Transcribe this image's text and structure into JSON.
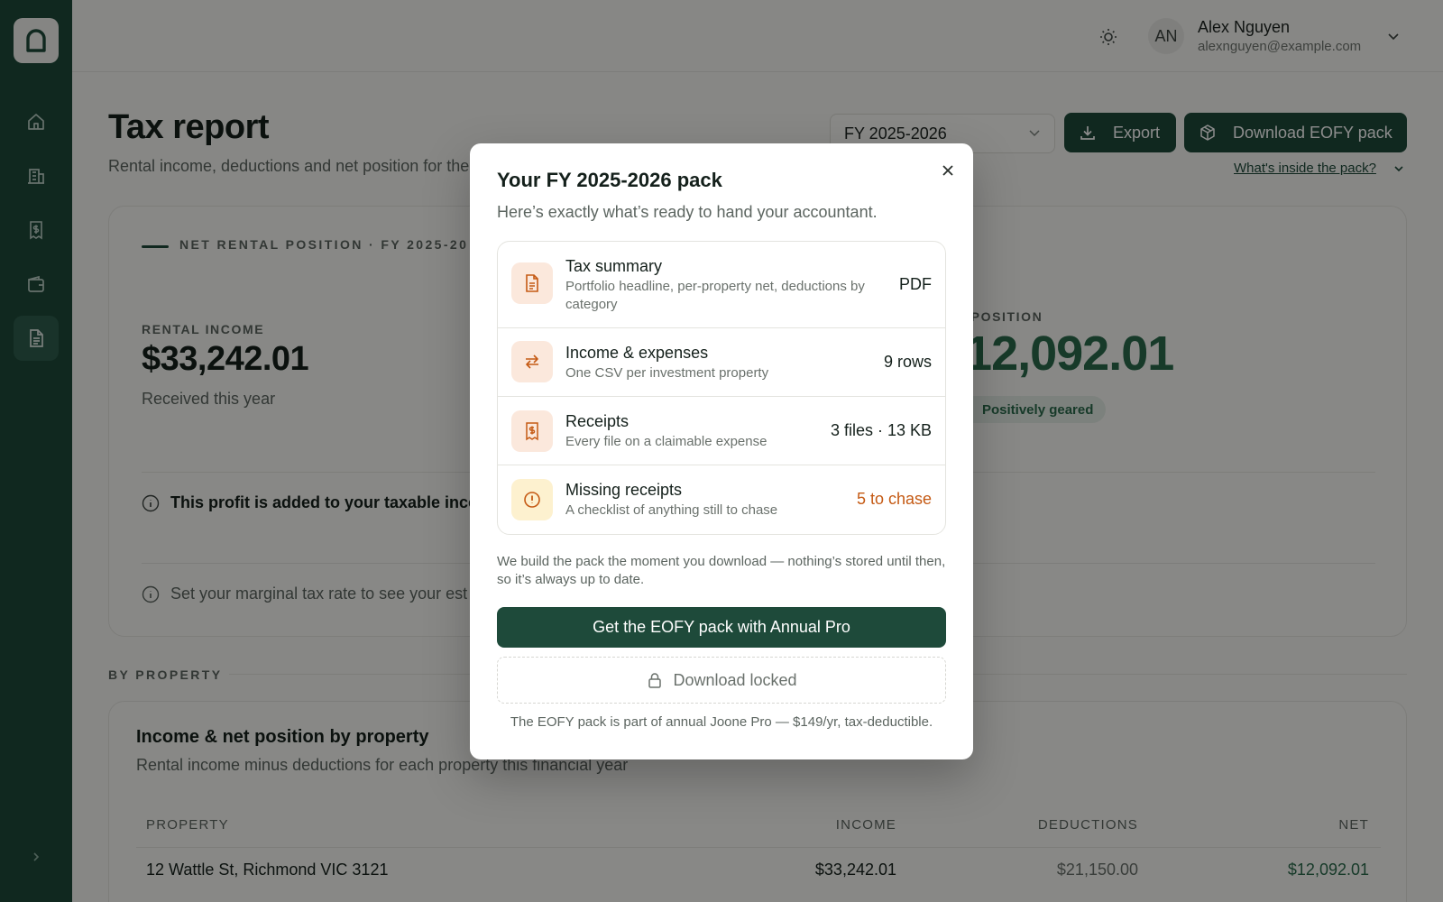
{
  "user": {
    "initials": "AN",
    "name": "Alex Nguyen",
    "email": "alexnguyen@example.com"
  },
  "header": {
    "title": "Tax report",
    "subtitle": "Rental income, deductions and net position for the",
    "fy_select": "FY 2025-2026",
    "export_label": "Export",
    "eofy_label": "Download EOFY pack",
    "inside_link": "What's inside the pack?"
  },
  "summary": {
    "eyebrow": "NET RENTAL POSITION · FY 2025-20",
    "income_label": "RENTAL INCOME",
    "income_value": "$33,242.01",
    "income_sub": "Received this year",
    "net_label": "T POSITION",
    "net_value": "$12,092.01",
    "net_badge": "Positively geared",
    "info1": "This profit is added to your taxable inco",
    "info2": "Set your marginal tax rate to see your est"
  },
  "by_property": {
    "section_label": "BY PROPERTY",
    "title": "Income & net position by property",
    "subtitle": "Rental income minus deductions for each property this financial year",
    "columns": [
      "PROPERTY",
      "INCOME",
      "DEDUCTIONS",
      "NET"
    ],
    "rows": [
      {
        "property": "12 Wattle St, Richmond VIC 3121",
        "income": "$33,242.01",
        "deductions": "$21,150.00",
        "net": "$12,092.01"
      }
    ]
  },
  "modal": {
    "title": "Your FY 2025-2026 pack",
    "subtitle": "Here’s exactly what’s ready to hand your accountant.",
    "items": [
      {
        "name": "Tax summary",
        "desc": "Portfolio headline, per-property net, deductions by category",
        "meta": "PDF",
        "icon": "document-icon"
      },
      {
        "name": "Income & expenses",
        "desc": "One CSV per investment property",
        "meta": "9 rows",
        "icon": "arrows-swap-icon"
      },
      {
        "name": "Receipts",
        "desc": "Every file on a claimable expense",
        "meta": "3 files · 13 KB",
        "icon": "receipt-icon"
      },
      {
        "name": "Missing receipts",
        "desc": "A checklist of anything still to chase",
        "meta": "5 to chase",
        "icon": "alert-circle-icon"
      }
    ],
    "note": "We build the pack the moment you download — nothing’s stored until then, so it’s always up to date.",
    "cta": "Get the EOFY pack with Annual Pro",
    "locked": "Download locked",
    "footer": "The EOFY pack is part of annual Joone Pro — $149/yr, tax-deductible."
  },
  "colors": {
    "brand": "#1e4a3a",
    "accent_orange": "#c55a14",
    "positive": "#2a6a4c"
  }
}
